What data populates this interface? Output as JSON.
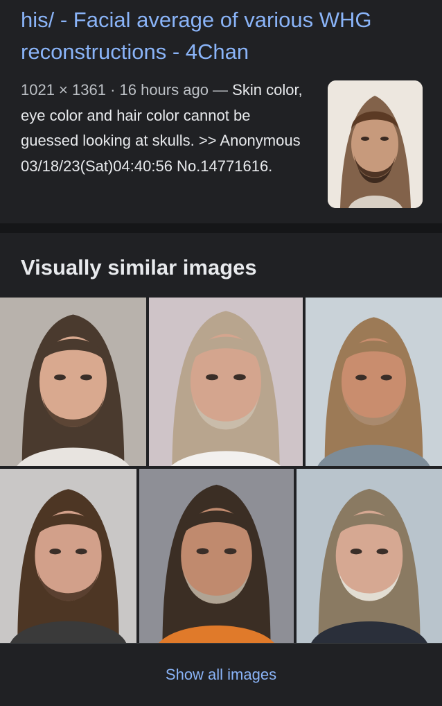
{
  "result": {
    "title": "his/ - Facial average of various WHG reconstructions - 4Chan",
    "meta": "1021 × 1361 · 16 hours ago — ",
    "snippet": "Skin color, eye color and hair color cannot be guessed looking at skulls. >> Anonymous 03/18/23(Sat)04:40:56 No.14771616.",
    "thumbnail_icon": "portrait-thumbnail"
  },
  "similar": {
    "heading": "Visually similar images",
    "show_all_label": "Show all images",
    "images": [
      {
        "name": "mugshot-1",
        "bg": "#b8b2ac",
        "hair": "#4a3a2e",
        "skin": "#d9a98f",
        "beard": "#5c4535",
        "shirt": "#e8e4e0"
      },
      {
        "name": "mugshot-2",
        "bg": "#cfc4c8",
        "hair": "#b8a58e",
        "skin": "#d4a58e",
        "beard": "#c9bcaa",
        "shirt": "#f2f0ee"
      },
      {
        "name": "mugshot-3",
        "bg": "#c9d2d8",
        "hair": "#9c7a56",
        "skin": "#c98d6e",
        "beard": "#a98a6e",
        "shirt": "#7d8c98"
      },
      {
        "name": "mugshot-4",
        "bg": "#c9c7c6",
        "hair": "#4d3624",
        "skin": "#d2a08a",
        "beard": "#5a4030",
        "shirt": "#3a3a3a"
      },
      {
        "name": "mugshot-5",
        "bg": "#8e8f96",
        "hair": "#3b2e24",
        "skin": "#c08a6e",
        "beard": "#b0a494",
        "shirt": "#e07a2a"
      },
      {
        "name": "mugshot-6",
        "bg": "#b9c4cc",
        "hair": "#8a7a62",
        "skin": "#d6a892",
        "beard": "#e2ddd2",
        "shirt": "#2a2f3a"
      }
    ]
  }
}
